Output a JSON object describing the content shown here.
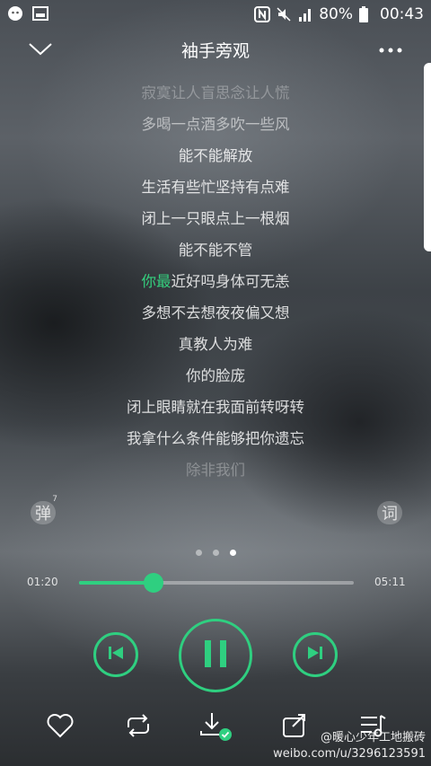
{
  "status_bar": {
    "battery": "80%",
    "time": "00:43",
    "icons": [
      "wechat-icon",
      "image-icon",
      "nfc-icon",
      "mute-icon",
      "signal-icon",
      "battery-icon"
    ]
  },
  "header": {
    "title": "袖手旁观",
    "back_icon": "chevron-down-icon",
    "more_icon": "more-icon"
  },
  "lyrics": [
    {
      "text": "寂寞让人盲思念让人慌",
      "style": "dim"
    },
    {
      "text": "多喝一点酒多吹一些风",
      "style": "dim2"
    },
    {
      "text": "能不能解放",
      "style": "normal"
    },
    {
      "text": "生活有些忙坚持有点难",
      "style": "normal"
    },
    {
      "text": "闭上一只眼点上一根烟",
      "style": "normal"
    },
    {
      "text": "能不能不管",
      "style": "normal"
    },
    {
      "text_highlight": "你最",
      "text_rest": "近好吗身体可无恙",
      "style": "current"
    },
    {
      "text": "多想不去想夜夜偏又想",
      "style": "normal"
    },
    {
      "text": "真教人为难",
      "style": "normal"
    },
    {
      "text": "你的脸庞",
      "style": "normal"
    },
    {
      "text": "闭上眼睛就在我面前转呀转",
      "style": "normal"
    },
    {
      "text": "我拿什么条件能够把你遗忘",
      "style": "normal"
    },
    {
      "text": "除非我们",
      "style": "dim"
    }
  ],
  "side_buttons": {
    "danmu_label": "弹",
    "danmu_count": "7",
    "lyric_label": "词"
  },
  "pager": {
    "count": 3,
    "active": 2
  },
  "player": {
    "current_time": "01:20",
    "total_time": "05:11",
    "progress": 0.27,
    "accent": "#2fcf80"
  },
  "bottom_bar": {
    "icons": [
      "heart-icon",
      "repeat-icon",
      "download-icon",
      "share-icon",
      "playlist-icon"
    ]
  },
  "watermark": {
    "line1": "@暖心少年工地搬砖",
    "line2": "weibo.com/u/3296123591"
  }
}
